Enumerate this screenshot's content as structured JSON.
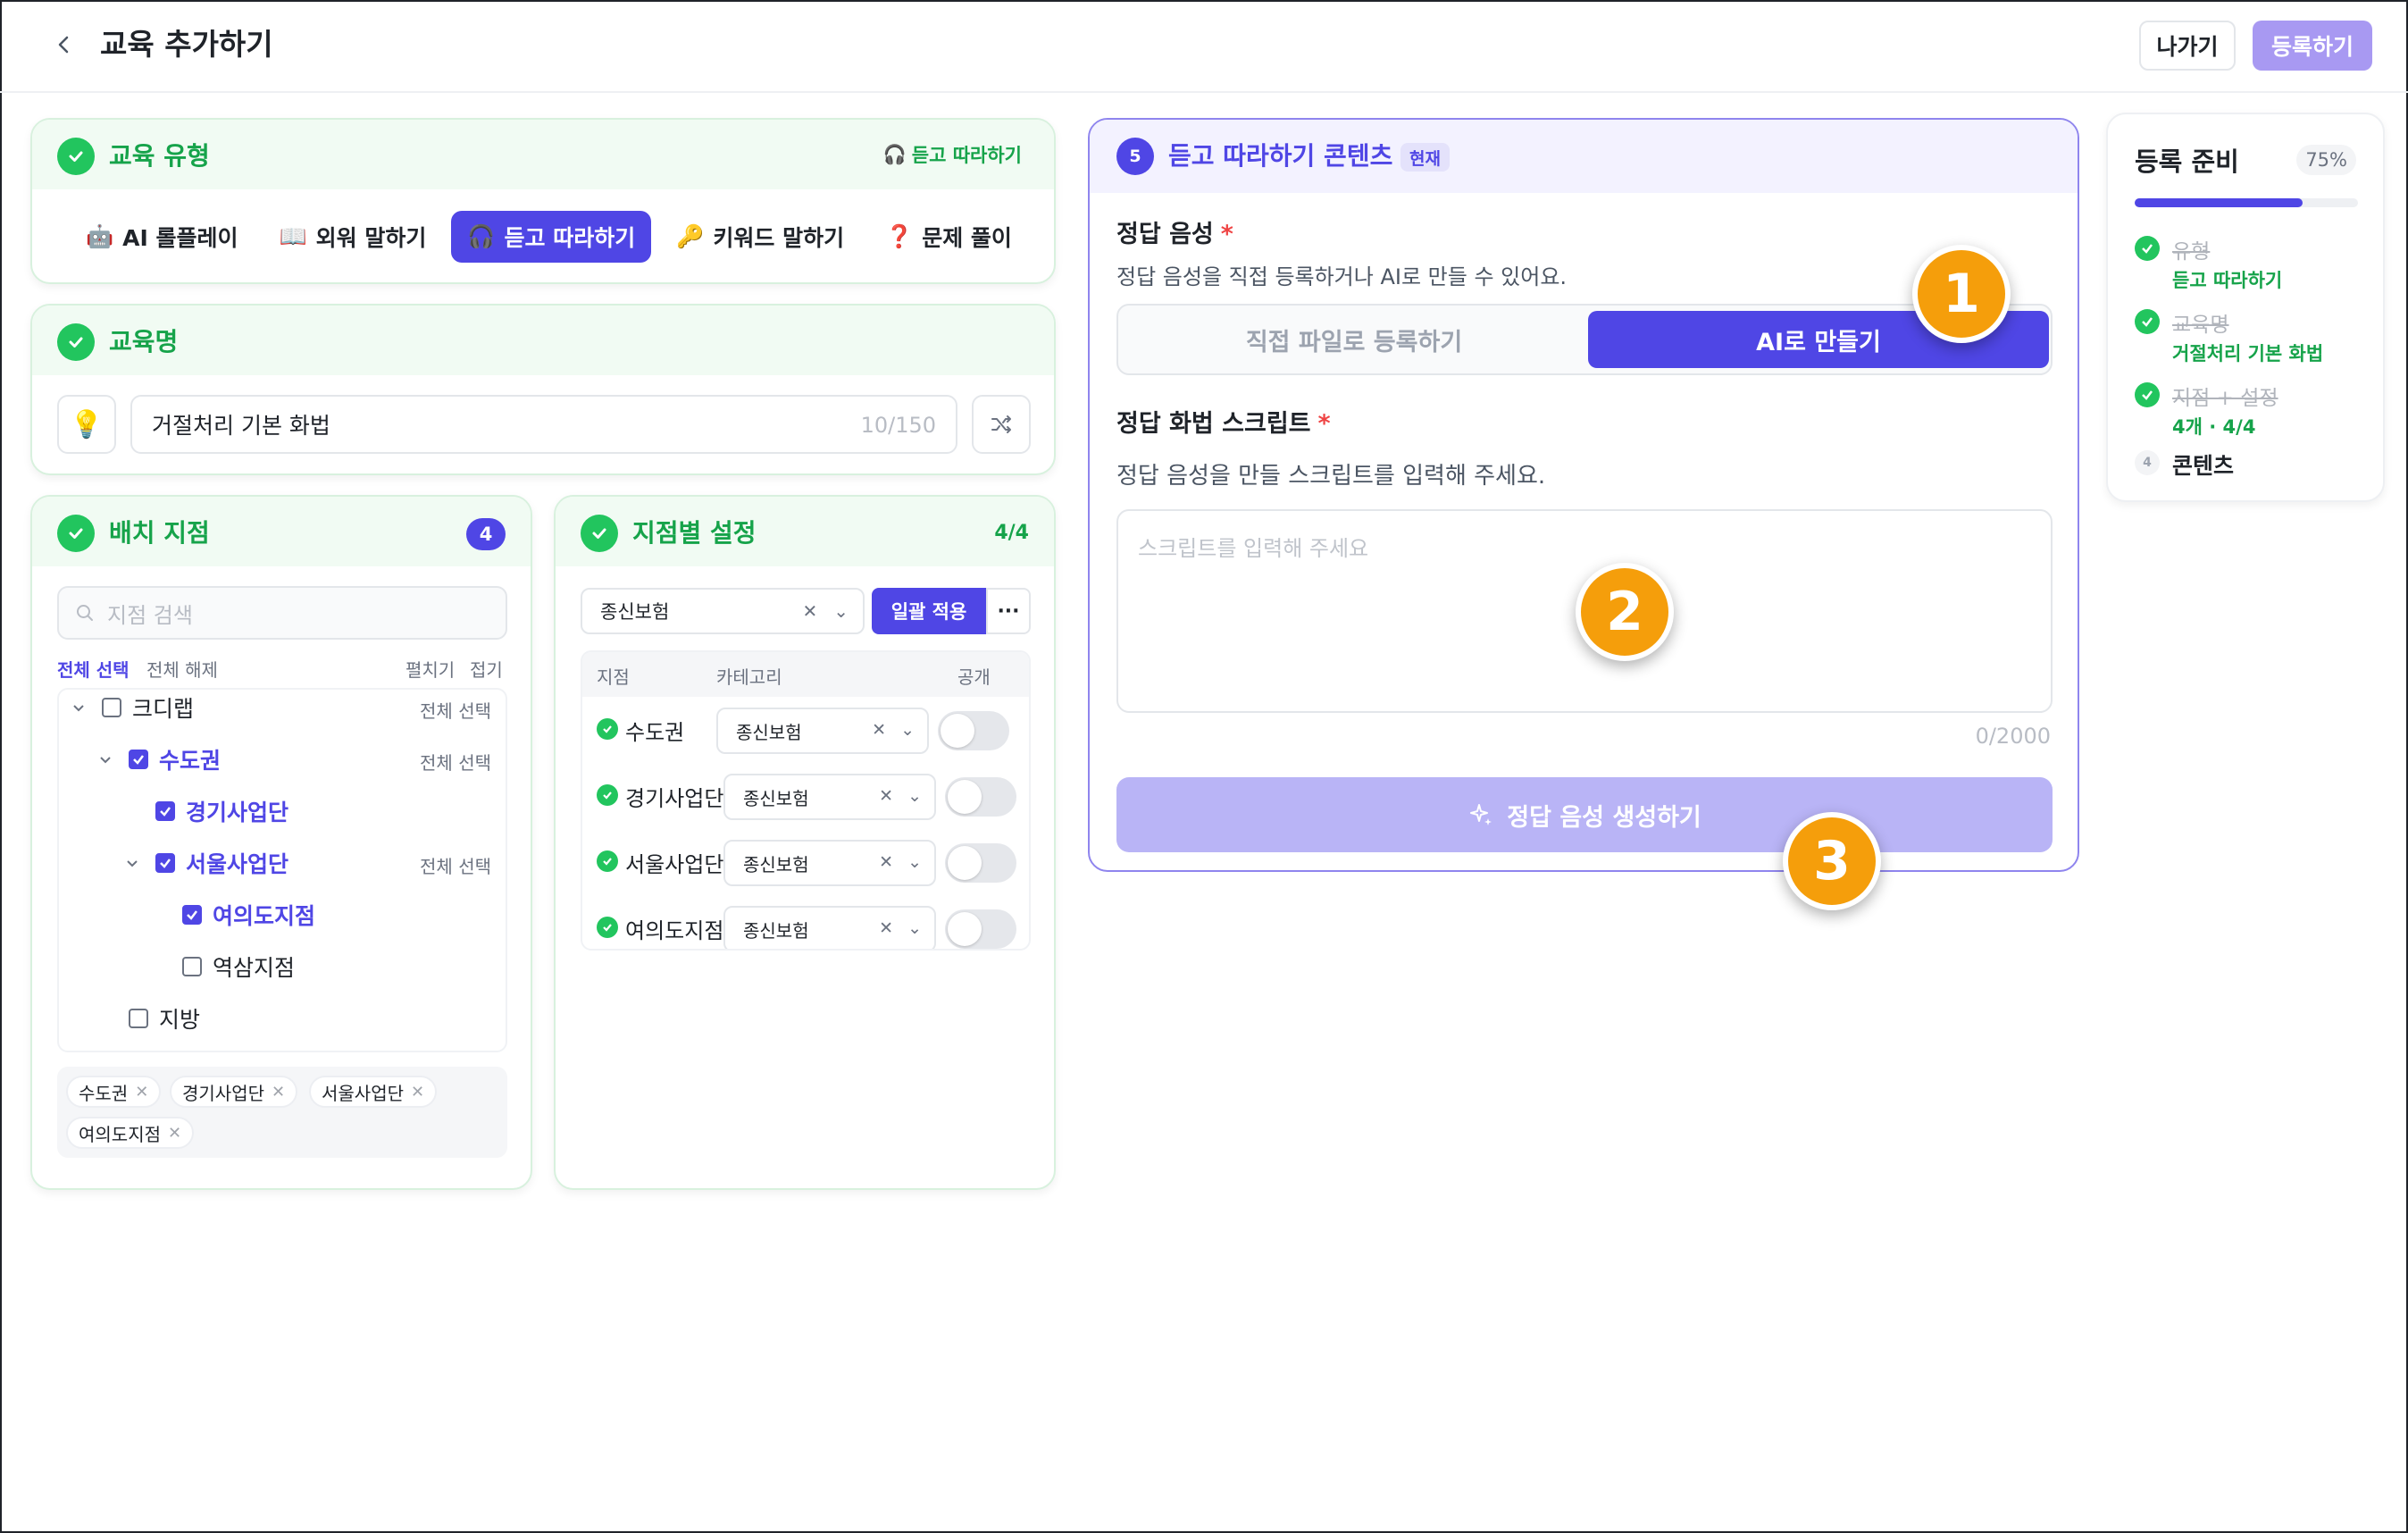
{
  "header": {
    "title": "교육 추가하기",
    "exit_label": "나가기",
    "register_label": "등록하기"
  },
  "type_card": {
    "title": "교육 유형",
    "selected_tag": "듣고 따라하기",
    "tabs": [
      {
        "label": "AI 롤플레이",
        "icon": "robot-icon"
      },
      {
        "label": "외워 말하기",
        "icon": "book-icon"
      },
      {
        "label": "듣고 따라하기",
        "icon": "headphones-icon",
        "active": true
      },
      {
        "label": "키워드 말하기",
        "icon": "key-icon"
      },
      {
        "label": "문제 풀이",
        "icon": "question-icon"
      }
    ]
  },
  "name_card": {
    "title": "교육명",
    "value": "거절처리 기본 화법",
    "count": "10/150"
  },
  "branch_card": {
    "title": "배치 지점",
    "count": "4",
    "search_placeholder": "지점 검색",
    "select_all": "전체 선택",
    "deselect_all": "전체 해제",
    "expand": "펼치기",
    "collapse": "접기",
    "tree": [
      {
        "label": "크디랩",
        "checked": false,
        "action": "전체 선택"
      },
      {
        "label": "수도권",
        "checked": true,
        "action": "전체 선택"
      },
      {
        "label": "경기사업단",
        "checked": true
      },
      {
        "label": "서울사업단",
        "checked": true,
        "action": "전체 선택"
      },
      {
        "label": "여의도지점",
        "checked": true
      },
      {
        "label": "역삼지점",
        "checked": false
      },
      {
        "label": "지방",
        "checked": false
      }
    ],
    "chips": [
      "수도권",
      "경기사업단",
      "서울사업단",
      "여의도지점"
    ]
  },
  "settings_card": {
    "title": "지점별 설정",
    "count": "4/4",
    "category_value": "종신보험",
    "apply_label": "일괄 적용",
    "more_label": "···",
    "columns": [
      "지점",
      "카테고리",
      "공개"
    ],
    "rows": [
      {
        "branch": "수도권",
        "category": "종신보험",
        "public": false
      },
      {
        "branch": "경기사업단",
        "category": "종신보험",
        "public": false
      },
      {
        "branch": "서울사업단",
        "category": "종신보험",
        "public": false
      },
      {
        "branch": "여의도지점",
        "category": "종신보험",
        "public": false
      }
    ]
  },
  "content_card": {
    "step": "5",
    "title": "듣고 따라하기 콘텐츠",
    "now_badge": "현재",
    "audio_label": "정답 음성",
    "audio_desc": "정답 음성을 직접 등록하거나 AI로 만들 수 있어요.",
    "seg_file": "직접 파일로 등록하기",
    "seg_ai": "AI로 만들기",
    "script_label": "정답 화법 스크립트",
    "script_desc": "정답 음성을 만들 스크립트를 입력해 주세요.",
    "script_placeholder": "스크립트를 입력해 주세요",
    "script_count": "0/2000",
    "generate_label": "정답 음성 생성하기"
  },
  "markers": [
    "1",
    "2",
    "3"
  ],
  "ready_card": {
    "title": "등록 준비",
    "percent": "75%",
    "progress": 0.75,
    "steps": [
      {
        "name": "유형",
        "sub": "듣고 따라하기",
        "done": true
      },
      {
        "name": "교육명",
        "sub": "거절처리 기본 화법",
        "done": true
      },
      {
        "name": "지점 + 설정",
        "sub": "4개 · 4/4",
        "done": true
      },
      {
        "name": "콘텐츠",
        "num": "4",
        "done": false
      }
    ]
  },
  "colors": {
    "accent": "#4f46e5",
    "success": "#22c55e",
    "marker": "#f59e0b"
  }
}
